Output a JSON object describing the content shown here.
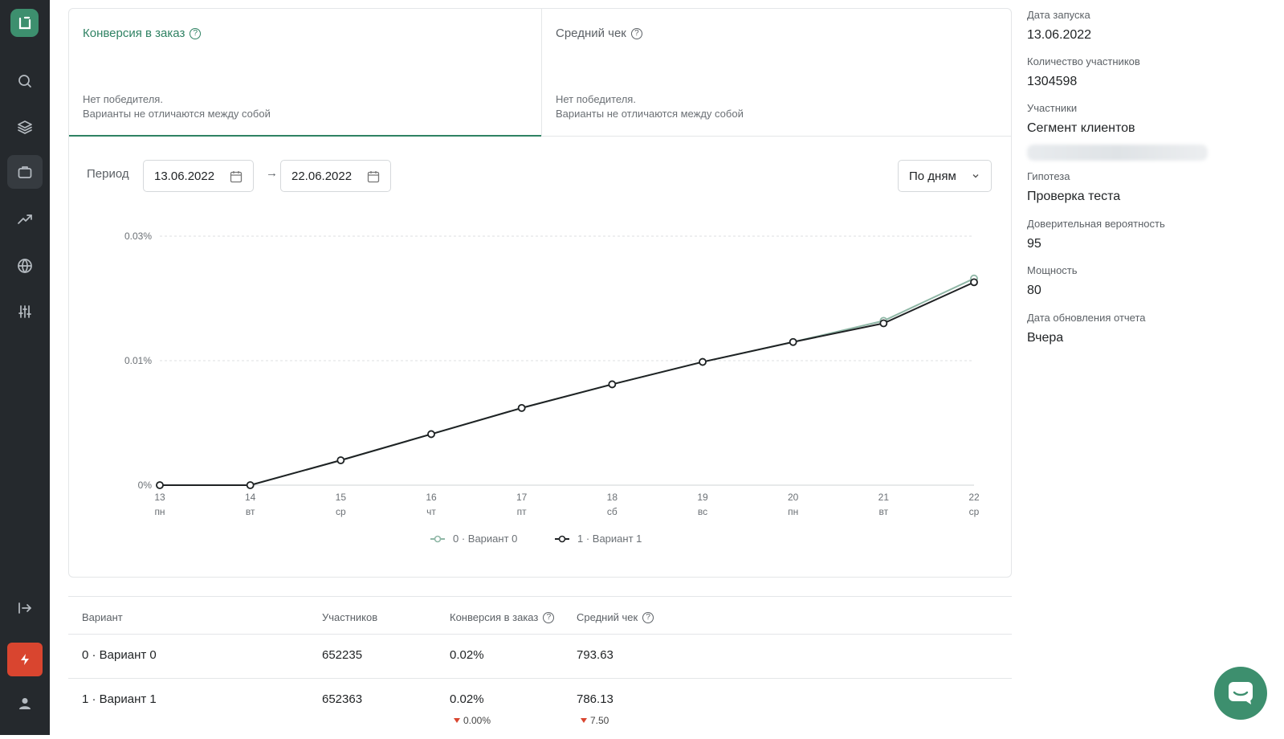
{
  "tabs": [
    {
      "title": "Конверсия в заказ",
      "status_line1": "Нет победителя.",
      "status_line2": "Варианты не отличаются между собой"
    },
    {
      "title": "Средний чек",
      "status_line1": "Нет победителя.",
      "status_line2": "Варианты не отличаются между собой"
    }
  ],
  "period": {
    "label": "Период",
    "start": "13.06.2022",
    "end": "22.06.2022",
    "arrow": "→"
  },
  "granularity": {
    "selected": "По дням"
  },
  "chart_data": {
    "type": "line",
    "x_day": [
      "13",
      "14",
      "15",
      "16",
      "17",
      "18",
      "19",
      "20",
      "21",
      "22"
    ],
    "x_weekday": [
      "пн",
      "вт",
      "ср",
      "чт",
      "пт",
      "сб",
      "вс",
      "пн",
      "вт",
      "ср"
    ],
    "y_ticks": [
      "0%",
      "0.01%",
      "0.03%"
    ],
    "y_tick_values": [
      0,
      0.01,
      0.02
    ],
    "series": [
      {
        "name": "0 · Вариант 0",
        "color": "#8fb7a6",
        "values": [
          0,
          0,
          0.002,
          0.0041,
          0.0062,
          0.0081,
          0.0099,
          0.0115,
          0.0132,
          0.0166
        ]
      },
      {
        "name": "1 · Вариант 1",
        "color": "#1f2224",
        "values": [
          0,
          0,
          0.002,
          0.0041,
          0.0062,
          0.0081,
          0.0099,
          0.0115,
          0.013,
          0.0163
        ]
      }
    ],
    "ylim": [
      0,
      0.02
    ],
    "legend": "bottom-center",
    "grid": true
  },
  "table": {
    "headers": [
      "Вариант",
      "Участников",
      "Конверсия в заказ",
      "Средний чек"
    ],
    "rows": [
      {
        "variant": "0 · Вариант 0",
        "participants": "652235",
        "conversion": "0.02%",
        "avg_check": "793.63"
      },
      {
        "variant": "1 · Вариант 1",
        "participants": "652363",
        "conversion": "0.02%",
        "avg_check": "786.13",
        "conversion_delta": "0.00%",
        "avg_check_delta": "7.50"
      }
    ]
  },
  "info": [
    {
      "label": "Дата запуска",
      "value": "13.06.2022"
    },
    {
      "label": "Количество участников",
      "value": "1304598"
    },
    {
      "label": "Участники",
      "value": "Сегмент клиентов"
    },
    {
      "label": "Гипотеза",
      "value": "Проверка теста"
    },
    {
      "label": "Доверительная вероятность",
      "value": "95"
    },
    {
      "label": "Мощность",
      "value": "80"
    },
    {
      "label": "Дата обновления отчета",
      "value": "Вчера"
    }
  ],
  "icons": {
    "sidebar": [
      "search-icon",
      "layers-icon",
      "briefcase-icon",
      "trend-icon",
      "globe-icon",
      "sliders-icon",
      "logout-icon",
      "bolt-icon",
      "user-icon"
    ],
    "accent": "#2f8263"
  }
}
